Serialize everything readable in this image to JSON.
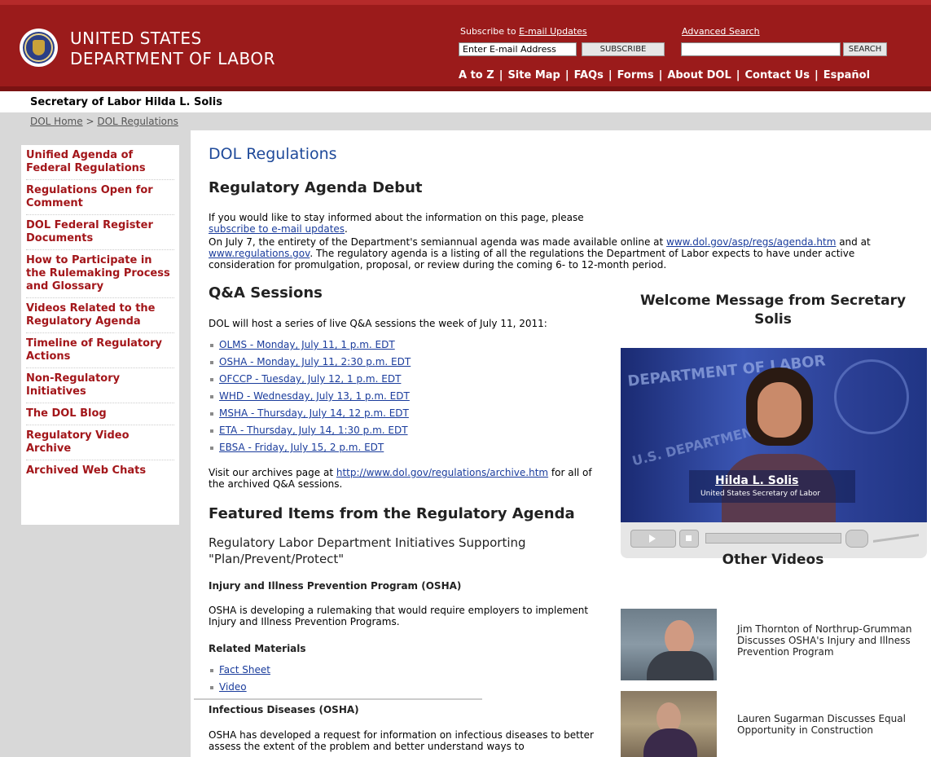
{
  "header": {
    "agency_line1": "UNITED STATES",
    "agency_line2": "DEPARTMENT OF LABOR",
    "subscribe_prefix": "Subscribe to ",
    "subscribe_link": "E-mail Updates",
    "email_placeholder": "Enter E-mail Address",
    "subscribe_button": "SUBSCRIBE",
    "advanced_search": "Advanced Search",
    "search_button": "SEARCH",
    "nav": [
      "A to Z",
      "Site Map",
      "FAQs",
      "Forms",
      "About DOL",
      "Contact Us",
      "Español"
    ],
    "sep": "|"
  },
  "secretary": "Secretary of Labor Hilda L. Solis",
  "breadcrumb": {
    "home": "DOL Home",
    "sep": ">",
    "current": "DOL Regulations"
  },
  "sidebar": {
    "items": [
      "Unified Agenda of Federal Regulations",
      "Regulations Open for Comment",
      "DOL Federal Register Documents",
      "How to Participate in the Rulemaking Process and Glossary",
      "Videos Related to the Regulatory Agenda",
      "Timeline of Regulatory Actions",
      "Non-Regulatory Initiatives",
      "The DOL Blog",
      "Regulatory Video Archive",
      "Archived Web Chats"
    ]
  },
  "main": {
    "title": "DOL Regulations",
    "debut_heading": "Regulatory Agenda Debut",
    "stay_informed_prefix": "If you would like to stay informed about the information on this page, please ",
    "stay_informed_link": "subscribe to e-mail updates",
    "stay_informed_suffix": ".",
    "agenda_p_prefix": "On July 7, the entirety of the Department's semiannual agenda was made available online at ",
    "agenda_link1": "www.dol.gov/asp/regs/agenda.htm",
    "agenda_p_mid": " and at ",
    "agenda_link2": "www.regulations.gov",
    "agenda_p_suffix": ". The regulatory agenda is a listing of all the regulations the Department of Labor expects to have under active consideration for promulgation, proposal, or review during the coming 6- to 12-month period.",
    "qa_heading": "Q&A Sessions",
    "qa_intro": "DOL will host a series of live Q&A sessions the week of July 11, 2011:",
    "qa_sessions": [
      "OLMS - Monday, July 11, 1 p.m. EDT",
      "OSHA - Monday, July 11, 2:30 p.m. EDT",
      "OFCCP - Tuesday, July 12, 1 p.m. EDT",
      "WHD - Wednesday, July 13, 1 p.m. EDT",
      "MSHA - Thursday, July 14, 12 p.m. EDT",
      "ETA - Thursday, July 14, 1:30 p.m. EDT",
      "EBSA - Friday, July 15, 2 p.m. EDT"
    ],
    "archive_prefix": "Visit our archives page at ",
    "archive_link": "http://www.dol.gov/regulations/archive.htm",
    "archive_suffix": " for all of the archived Q&A sessions.",
    "featured_heading": "Featured Items from the Regulatory Agenda",
    "initiatives_heading": "Regulatory Labor Department Initiatives Supporting \"Plan/Prevent/Protect\"",
    "iipp_heading": "Injury and Illness Prevention Program (OSHA)",
    "iipp_text": "OSHA is developing a rulemaking that would require employers to implement Injury and Illness Prevention Programs.",
    "related_heading": "Related Materials",
    "related": [
      "Fact Sheet",
      "Video"
    ],
    "infectious_heading": "Infectious Diseases (OSHA)",
    "infectious_text": "OSHA has developed a request for information on infectious diseases to better assess the extent of the problem and better understand ways to"
  },
  "right": {
    "welcome_heading": "Welcome Message from Secretary Solis",
    "video_bg_text1": "DEPARTMENT OF LABOR",
    "video_bg_text2": "U.S. DEPARTMENT",
    "video_name": "Hilda L. Solis",
    "video_title": "United States Secretary of Labor",
    "other_videos_heading": "Other Videos",
    "other_videos": [
      "Jim Thornton of Northrup-Grumman Discusses OSHA's Injury and Illness Prevention Program",
      "Lauren Sugarman Discusses Equal Opportunity in Construction"
    ]
  },
  "colors": {
    "header_red": "#9b1b1b",
    "nav_red": "#a3161a",
    "link_blue": "#1a3c9c",
    "title_blue": "#1f4a9a",
    "gray_bar": "#d8d8d8"
  }
}
